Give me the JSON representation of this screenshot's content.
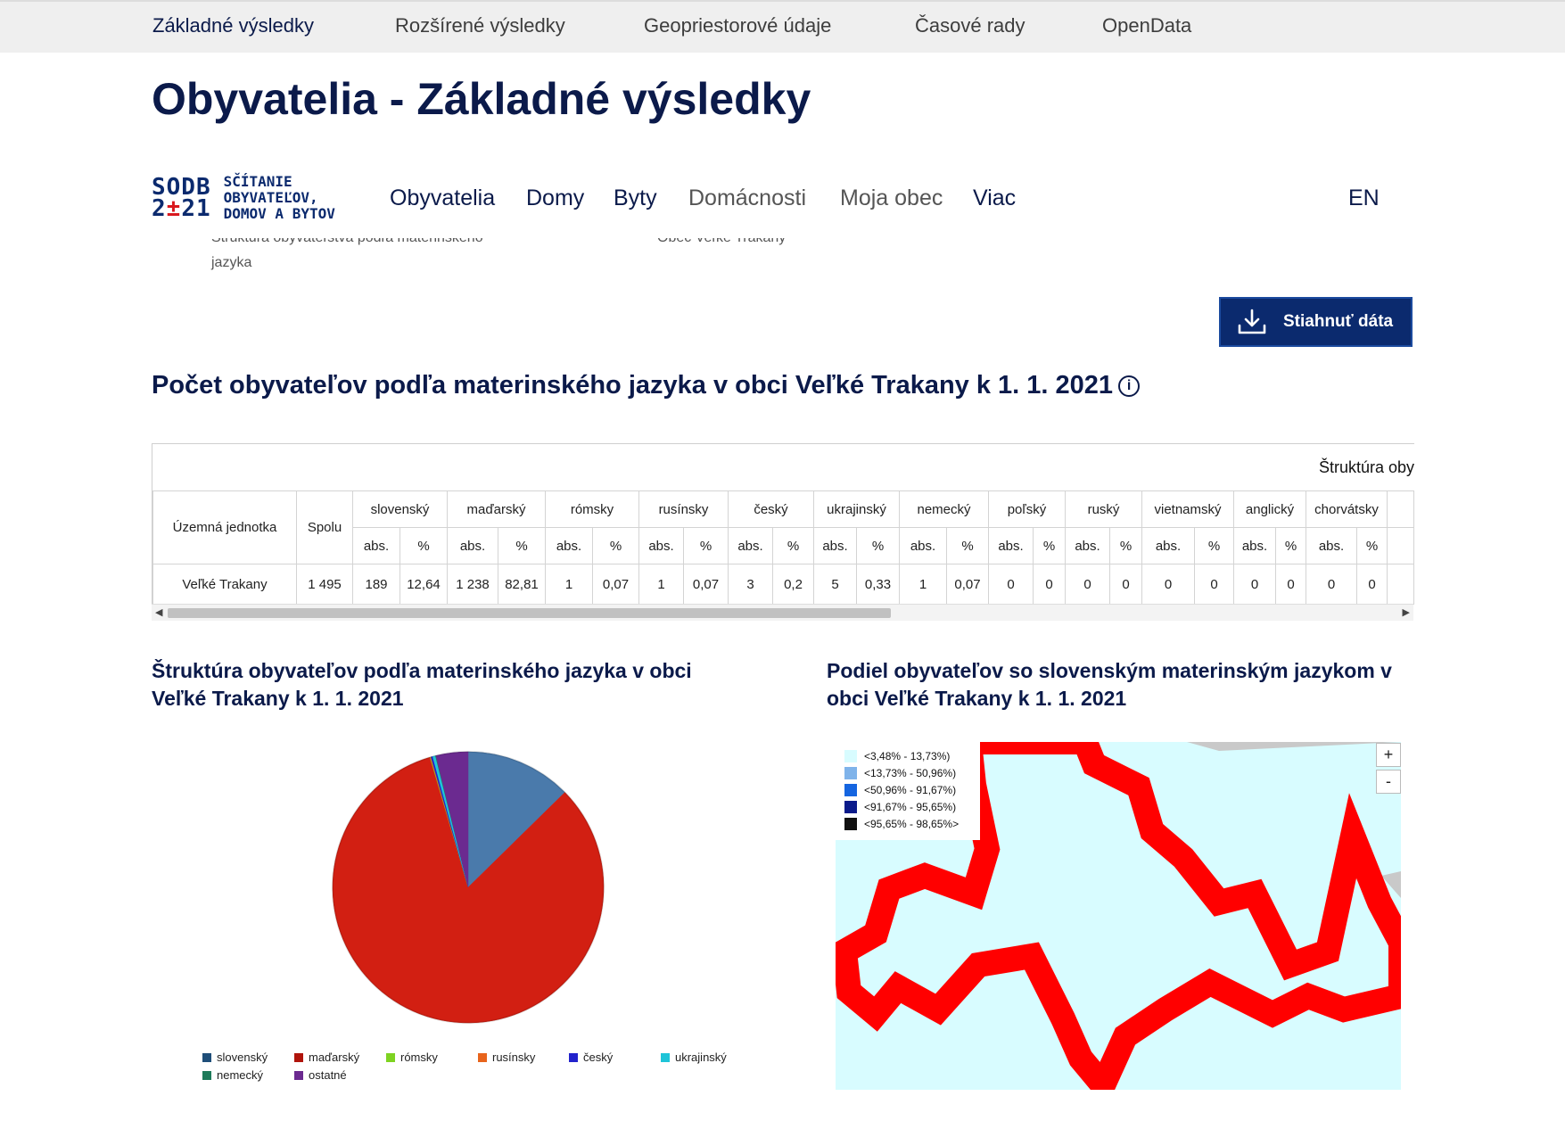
{
  "top_nav": [
    "Základné výsledky",
    "Rozšírené výsledky",
    "Geopriestorové údaje",
    "Časové rady",
    "OpenData"
  ],
  "page_title": "Obyvatelia - Základné výsledky",
  "logo": {
    "line1": "SODB",
    "line2_a": "2",
    "line2_b": "±",
    "line2_c": "21",
    "text1": "SČÍTANIE",
    "text2": "OBYVATEĽOV,",
    "text3": "DOMOV A BYTOV"
  },
  "main_nav": [
    "Obyvatelia",
    "Domy",
    "Byty",
    "Domácnosti",
    "Moja obec",
    "Viac"
  ],
  "lang": "EN",
  "breadcrumb": {
    "left_line1": "Štruktúra obyvateľstva podľa materinského",
    "left_line2": "jazyka",
    "right": "Obec Veľké Trakany"
  },
  "download_label": "Stiahnuť dáta",
  "section_title": "Počet obyvateľov podľa materinského jazyka v obci Veľké Trakany k 1. 1. 2021",
  "table": {
    "caption": "Štruktúra oby",
    "col_territory": "Územná jednotka",
    "col_total": "Spolu",
    "abs_label": "abs.",
    "pct_label": "%",
    "languages": [
      "slovenský",
      "maďarský",
      "rómsky",
      "rusínsky",
      "český",
      "ukrajinský",
      "nemecký",
      "poľský",
      "ruský",
      "vietnamský",
      "anglický",
      "chorvátsky"
    ],
    "row": {
      "territory": "Veľké Trakany",
      "total": "1 495",
      "cells": [
        "189",
        "12,64",
        "1 238",
        "82,81",
        "1",
        "0,07",
        "1",
        "0,07",
        "3",
        "0,2",
        "5",
        "0,33",
        "1",
        "0,07",
        "0",
        "0",
        "0",
        "0",
        "0",
        "0",
        "0",
        "0",
        "0",
        "0"
      ]
    }
  },
  "pie_title": "Štruktúra obyvateľov podľa materinského jazyka v obci Veľké Trakany k 1. 1. 2021",
  "chart_data": {
    "type": "pie",
    "categories": [
      "slovenský",
      "maďarský",
      "rómsky",
      "rusínsky",
      "český",
      "ukrajinský",
      "nemecký",
      "ostatné"
    ],
    "values": [
      189,
      1238,
      1,
      1,
      3,
      5,
      1,
      57
    ],
    "colors": [
      "#4a7aab",
      "#d21f12",
      "#7ed321",
      "#e8641c",
      "#2222cc",
      "#1fc4d8",
      "#1e7b5a",
      "#6b2a90"
    ],
    "legend_position": "bottom"
  },
  "map_title": "Podiel obyvateľov so slovenským materinským jazykom v obci Veľké Trakany k 1. 1. 2021",
  "map_legend": [
    {
      "label": "<3,48% - 13,73%)",
      "color": "#d8fcff"
    },
    {
      "label": "<13,73% - 50,96%)",
      "color": "#7fb3ea"
    },
    {
      "label": "<50,96% - 91,67%)",
      "color": "#1565e0"
    },
    {
      "label": "<91,67% - 95,65%)",
      "color": "#0a1a8a"
    },
    {
      "label": "<95,65% - 98,65%>",
      "color": "#111111"
    }
  ],
  "zoom_in": "+",
  "zoom_out": "-",
  "colors": {
    "navy": "#0b1a4a",
    "accent": "#0b2a6e",
    "logo_red": "#d9191e",
    "map_fill": "#d8fcff",
    "map_border": "#ff0000"
  }
}
